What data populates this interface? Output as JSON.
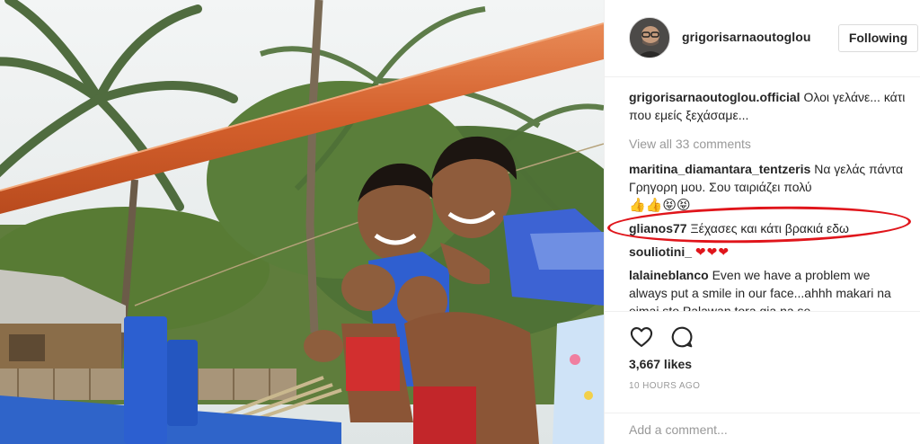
{
  "post": {
    "username": "grigorisarnaoutoglou",
    "follow_label": "Following"
  },
  "comments": {
    "caption": {
      "user": "grigorisarnaoutoglou.official",
      "text": "Ολοι γελάνε... κάτι που εμείς ξεχάσαμε..."
    },
    "view_all": "View all 33 comments",
    "items": [
      {
        "user": "maritina_diamantara_tentzeris",
        "text": "Να γελάς πάντα Γρηγορη μου. Σου ταιριάζει πολύ",
        "extra": "👍👍😝😝"
      },
      {
        "user": "glianos77",
        "text": "Ξέχασες και κάτι βρακιά εδω",
        "extra": ""
      },
      {
        "user": "souliotini_",
        "text": "",
        "extra": "❤❤❤"
      },
      {
        "user": "lalaineblanco",
        "text": "Even we have a problem we always put a smile in our face...ahhh makari na eimai sto Palawan tora gia na se",
        "extra": ""
      }
    ]
  },
  "actions": {
    "like_icon": "heart-outline-icon",
    "comment_icon": "speech-bubble-icon",
    "likes": "3,667 likes",
    "time": "10 HOURS AGO"
  },
  "add_comment": {
    "placeholder": "Add a comment..."
  },
  "colors": {
    "highlight": "#e0151b",
    "muted_text": "#999999",
    "primary_text": "#262626"
  }
}
